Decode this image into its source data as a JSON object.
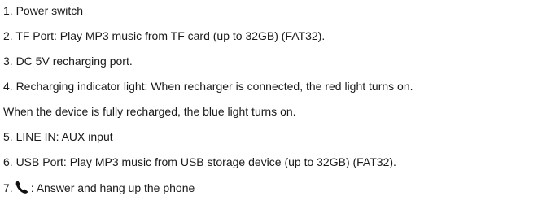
{
  "items": [
    "1. Power switch",
    "2. TF Port: Play MP3 music from TF card (up to 32GB) (FAT32).",
    "3. DC 5V recharging port.",
    "4. Recharging indicator light: When recharger is connected, the red light turns on.",
    "When the device is fully recharged, the blue light turns on.",
    "5. LINE IN: AUX input",
    "6. USB Port: Play MP3 music from USB storage device (up to 32GB) (FAT32).",
    {
      "prefix": "7.",
      "icon": "phone-handset-icon",
      "text": ": Answer and hang up the phone"
    }
  ]
}
